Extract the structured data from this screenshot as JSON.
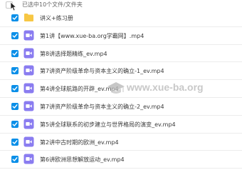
{
  "header": {
    "selection_text": "已选中10个文件/文件夹"
  },
  "rows": [
    {
      "type": "folder",
      "name": "讲义+练习册"
    },
    {
      "type": "video",
      "name": "第1讲【www.xue-ba.org学霸网】.mp4"
    },
    {
      "type": "video",
      "name": "第8讲选择题精练_ev.mp4"
    },
    {
      "type": "video",
      "name": "第7讲资产阶级革命与资本主义的确立-1_ev.mp4"
    },
    {
      "type": "video",
      "name": "第4讲全球航路的开辟_ev.mp4"
    },
    {
      "type": "video",
      "name": "第7讲资产阶级革命与资本主义的确立-2_ev.mp4"
    },
    {
      "type": "video",
      "name": "第5讲全球联系的初步建立与世界格局的演变_ev.mp4"
    },
    {
      "type": "video",
      "name": "第2讲中古时期的欧洲_ev.mp4"
    },
    {
      "type": "video",
      "name": "第6讲欧洲思想解放运动_ev.mp4"
    }
  ],
  "watermark": {
    "text": "www.xue-ba.org"
  },
  "colors": {
    "checkbox": "#0a8fe8",
    "video_icon": "#8a7cf0",
    "folder_icon": "#f7c744"
  }
}
